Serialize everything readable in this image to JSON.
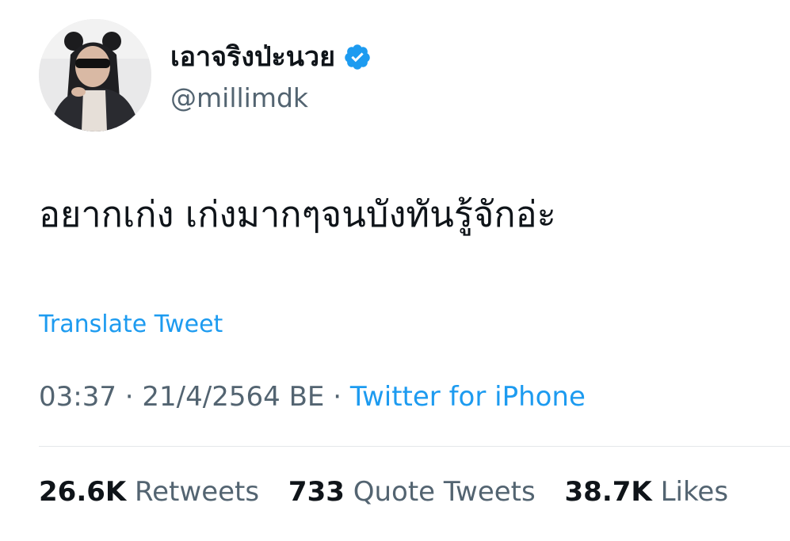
{
  "user": {
    "display_name": "เอาจริงป่ะนวย",
    "handle": "@millimdk",
    "verified": true
  },
  "tweet": {
    "text": "อยากเก่ง เก่งมากๆจนบังทันรู้จักอ่ะ",
    "translate_label": "Translate Tweet",
    "time": "03:37",
    "separator": "·",
    "date": "21/4/2564 BE",
    "source": "Twitter for iPhone"
  },
  "stats": {
    "retweets_count": "26.6K",
    "retweets_label": "Retweets",
    "quotes_count": "733",
    "quotes_label": "Quote Tweets",
    "likes_count": "38.7K",
    "likes_label": "Likes"
  },
  "colors": {
    "accent": "#1d9bf0",
    "secondary_text": "#536471",
    "primary_text": "#0f1419"
  },
  "icons": {
    "verified": "verified-badge-icon"
  }
}
